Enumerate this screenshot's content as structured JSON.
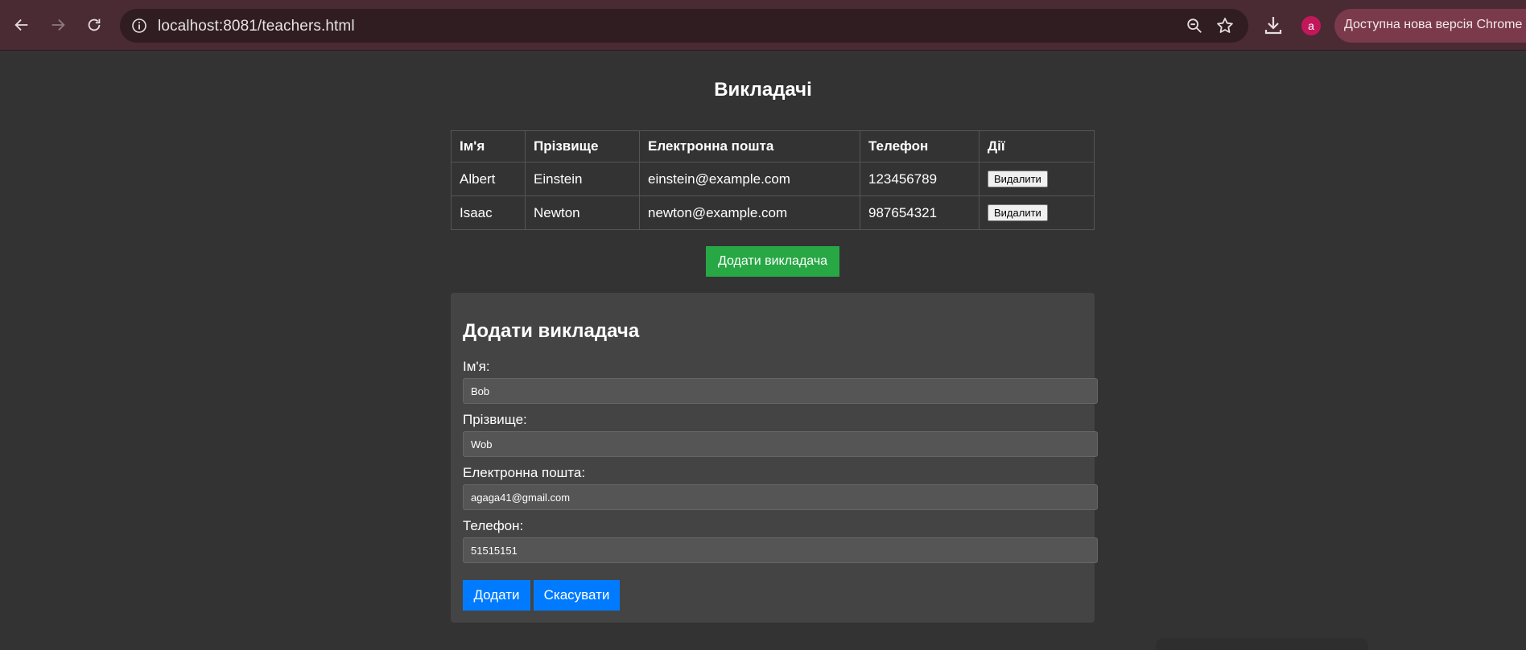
{
  "browser": {
    "url": "localhost:8081/teachers.html",
    "avatar_letter": "a",
    "update_text": "Доступна нова версія Chrome",
    "icons": [
      "back-icon",
      "forward-icon",
      "reload-icon",
      "info-icon",
      "zoom-icon",
      "star-icon",
      "download-icon"
    ]
  },
  "page": {
    "title": "Викладачі",
    "table": {
      "headers": [
        "Ім'я",
        "Прізвище",
        "Електронна пошта",
        "Телефон",
        "Дії"
      ],
      "rows": [
        {
          "first": "Albert",
          "last": "Einstein",
          "email": "einstein@example.com",
          "phone": "123456789",
          "action": "Видалити"
        },
        {
          "first": "Isaac",
          "last": "Newton",
          "email": "newton@example.com",
          "phone": "987654321",
          "action": "Видалити"
        }
      ]
    },
    "add_button": "Додати викладача",
    "form": {
      "heading": "Додати викладача",
      "first_name_label": "Ім'я:",
      "first_name_value": "Bob",
      "last_name_label": "Прізвище:",
      "last_name_value": "Wob",
      "email_label": "Електронна пошта:",
      "email_value": "agaga41@gmail.com",
      "phone_label": "Телефон:",
      "phone_value": "51515151",
      "submit_label": "Додати",
      "cancel_label": "Скасувати"
    }
  },
  "colors": {
    "background": "#333333",
    "toolbar": "#4a2a33",
    "add_button": "#28a745",
    "primary_button": "#007bff",
    "form_panel": "#444444"
  }
}
